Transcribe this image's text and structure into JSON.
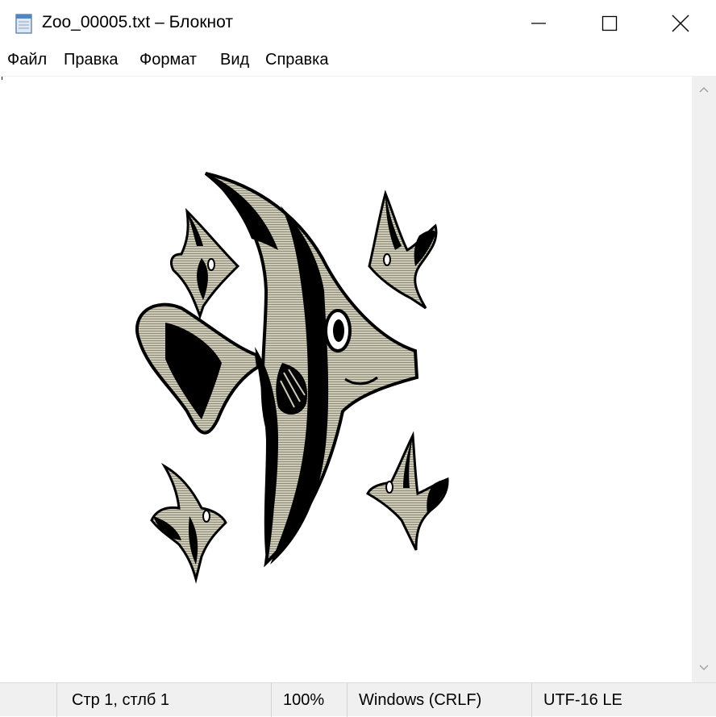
{
  "window": {
    "title": "Zoo_00005.txt – Блокнот",
    "app_icon": "notepad-icon",
    "controls": [
      "minimize-icon",
      "maximize-icon",
      "close-icon"
    ]
  },
  "menu": {
    "file": "Файл",
    "edit": "Правка",
    "format": "Формат",
    "view": "Вид",
    "help": "Справка"
  },
  "editor": {
    "content_description_icon": "angelfish-ascii-art",
    "colors": {
      "fish_fill": "#c4c1ad",
      "fish_stripe": "#000000",
      "background": "#ffffff"
    }
  },
  "scrollbar": {
    "up_icon": "chevron-up-icon",
    "down_icon": "chevron-down-icon"
  },
  "status": {
    "position": "Стр 1, стлб 1",
    "zoom": "100%",
    "line_endings": "Windows (CRLF)",
    "encoding": "UTF-16 LE"
  }
}
